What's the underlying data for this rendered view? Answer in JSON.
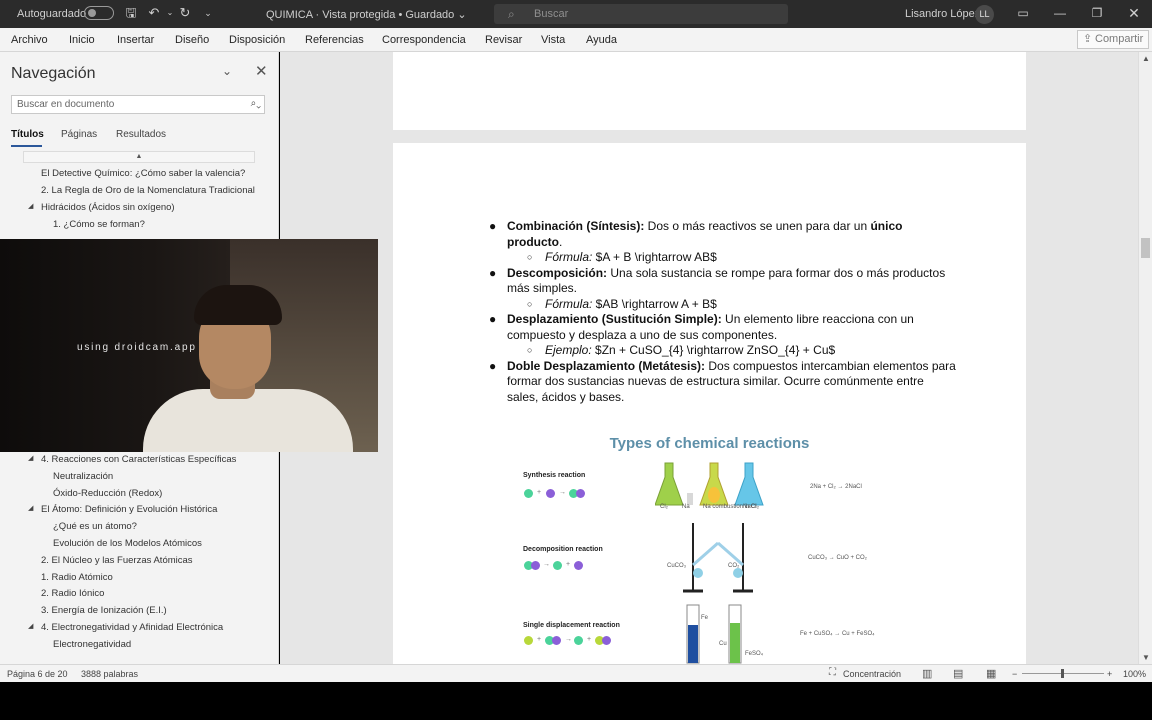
{
  "titlebar": {
    "autosave_label": "Autoguardado",
    "document_title": "QUIMICA  ·  Vista protegida  •  Guardado ⌄",
    "search_placeholder": "Buscar",
    "user_name": "Lisandro López",
    "user_initials": "LL"
  },
  "ribbon": {
    "tabs": [
      "Archivo",
      "Inicio",
      "Insertar",
      "Diseño",
      "Disposición",
      "Referencias",
      "Correspondencia",
      "Revisar",
      "Vista",
      "Ayuda"
    ],
    "share_label": "Compartir"
  },
  "nav": {
    "title": "Navegación",
    "search_placeholder": "Buscar en documento",
    "tabs": [
      "Títulos",
      "Páginas",
      "Resultados"
    ],
    "items": [
      {
        "text": "El Detective Químico: ¿Cómo saber la valencia?",
        "level": 1,
        "expanded": false
      },
      {
        "text": "2. La Regla de Oro de la Nomenclatura Tradicional",
        "level": 1,
        "expanded": false
      },
      {
        "text": "Hidrácidos (Ácidos sin oxígeno)",
        "level": 1,
        "expanded": true
      },
      {
        "text": "1. ¿Cómo se forman?",
        "level": 2,
        "expanded": false
      },
      {
        "text": "4. Reacciones con Características Específicas",
        "level": 1,
        "expanded": true
      },
      {
        "text": "Neutralización",
        "level": 2,
        "expanded": false
      },
      {
        "text": "Óxido-Reducción (Redox)",
        "level": 2,
        "expanded": false
      },
      {
        "text": "El Átomo: Definición y Evolución Histórica",
        "level": 1,
        "expanded": true
      },
      {
        "text": "¿Qué es un átomo?",
        "level": 2,
        "expanded": false
      },
      {
        "text": "Evolución de los Modelos Atómicos",
        "level": 2,
        "expanded": false
      },
      {
        "text": "2. El Núcleo y las Fuerzas Atómicas",
        "level": 1,
        "expanded": false
      },
      {
        "text": "1. Radio Atómico",
        "level": 1,
        "expanded": false
      },
      {
        "text": "2. Radio Iónico",
        "level": 1,
        "expanded": false
      },
      {
        "text": "3. Energía de Ionización (E.I.)",
        "level": 1,
        "expanded": false
      },
      {
        "text": "4. Electronegatividad y Afinidad Electrónica",
        "level": 1,
        "expanded": true
      },
      {
        "text": "Electronegatividad",
        "level": 2,
        "expanded": false
      }
    ]
  },
  "document": {
    "bullets": [
      {
        "title": "Combinación (Síntesis):",
        "text": " Dos o más reactivos se unen para dar un ",
        "bold_end": "único producto",
        "tail": ".",
        "sub_label": "Fórmula:",
        "sub_text": " $A + B \\rightarrow AB$"
      },
      {
        "title": "Descomposición:",
        "text": " Una sola sustancia se rompe para formar dos o más productos más simples.",
        "sub_label": "Fórmula:",
        "sub_text": " $AB \\rightarrow A + B$"
      },
      {
        "title": "Desplazamiento (Sustitución Simple):",
        "text": " Un elemento libre reacciona con un compuesto y desplaza a uno de sus componentes.",
        "sub_label": "Ejemplo:",
        "sub_text": " $Zn + CuSO_{4} \\rightarrow ZnSO_{4} + Cu$"
      },
      {
        "title": "Doble Desplazamiento (Metátesis):",
        "text": " Dos compuestos intercambian elementos para formar dos sustancias nuevas de estructura similar. Ocurre comúnmente entre sales, ácidos y bases."
      }
    ],
    "infographic": {
      "title": "Types of chemical reactions",
      "rows": [
        {
          "label": "Synthesis reaction",
          "equation": "2Na + Cl₂ → 2NaCl",
          "flask_labels": [
            "Cl₂",
            "Na",
            "Na combustion in Cl₂",
            "NaCl"
          ]
        },
        {
          "label": "Decomposition reaction",
          "equation": "CuCO₃ → CuO + CO₂",
          "flask_labels": [
            "CuCO₃",
            "CO₂"
          ]
        },
        {
          "label": "Single displacement reaction",
          "equation": "Fe + CuSO₄ → Cu + FeSO₄",
          "flask_labels": [
            "Fe",
            "Cu",
            "FeSO₄"
          ]
        }
      ]
    }
  },
  "webcam": {
    "caption": "using droidcam.app"
  },
  "status": {
    "page": "Página 6 de 20",
    "words": "3888 palabras",
    "focus": "Concentración",
    "zoom": "100%",
    "zoom_fraction": 0.5
  }
}
